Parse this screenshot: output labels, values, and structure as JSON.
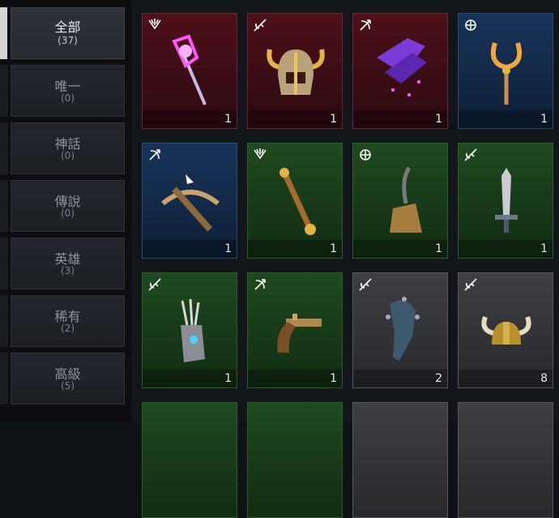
{
  "categories": [
    {
      "name": "全部",
      "count": "(37)",
      "active": true
    },
    {
      "name": "唯一",
      "count": "(0)"
    },
    {
      "name": "神話",
      "count": "(0)"
    },
    {
      "name": "傳說",
      "count": "(0)"
    },
    {
      "name": "英雄",
      "count": "(3)"
    },
    {
      "name": "稀有",
      "count": "(2)"
    },
    {
      "name": "高級",
      "count": "(5)"
    }
  ],
  "items": [
    {
      "name": "magic-staff",
      "rarity": "red",
      "class": "mage-icon",
      "qty": "1"
    },
    {
      "name": "horned-helmet",
      "rarity": "red",
      "class": "warrior-icon",
      "qty": "1"
    },
    {
      "name": "purple-wings",
      "rarity": "red",
      "class": "archer-icon",
      "qty": "1"
    },
    {
      "name": "ring-scepter",
      "rarity": "blue",
      "class": "cleric-icon",
      "qty": "1"
    },
    {
      "name": "crossbow",
      "rarity": "blue",
      "class": "archer-icon",
      "qty": "1"
    },
    {
      "name": "golden-rod",
      "rarity": "green",
      "class": "mage-icon",
      "qty": "1"
    },
    {
      "name": "broom",
      "rarity": "green",
      "class": "cleric-icon",
      "qty": "1"
    },
    {
      "name": "short-sword",
      "rarity": "green",
      "class": "warrior-icon",
      "qty": "1"
    },
    {
      "name": "claw-gauntlet",
      "rarity": "green",
      "class": "warrior-icon",
      "qty": "1"
    },
    {
      "name": "flintlock-pistol",
      "rarity": "green",
      "class": "archer-icon",
      "qty": "1"
    },
    {
      "name": "spiked-club",
      "rarity": "gray",
      "class": "warrior-icon",
      "qty": "2"
    },
    {
      "name": "viking-helmet",
      "rarity": "gray",
      "class": "warrior-icon",
      "qty": "8"
    }
  ]
}
